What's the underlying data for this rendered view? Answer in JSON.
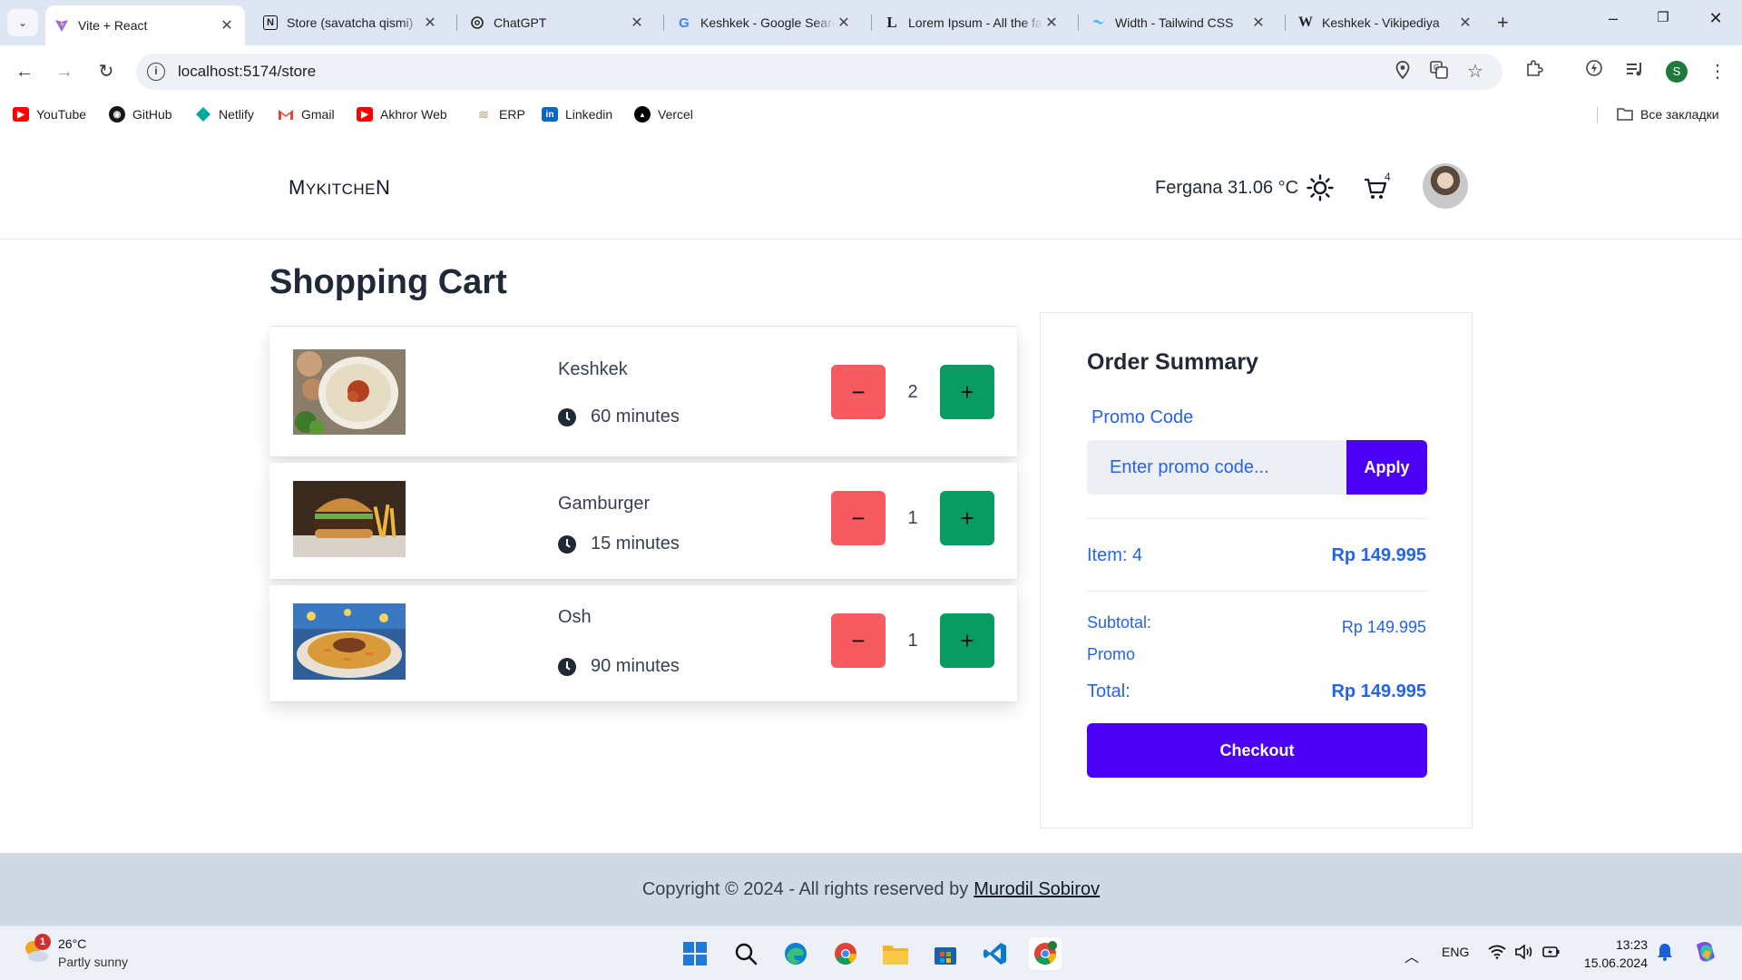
{
  "browser": {
    "tabs": [
      {
        "title": "Vite + React",
        "icon": "vite-icon",
        "active": true
      },
      {
        "title": "Store (savatcha qismi)",
        "icon": "notion-icon"
      },
      {
        "title": "ChatGPT",
        "icon": "chatgpt-icon"
      },
      {
        "title": "Keshkek - Google Search",
        "icon": "google-icon"
      },
      {
        "title": "Lorem Ipsum - All the facts",
        "icon": "lorem-icon"
      },
      {
        "title": "Width - Tailwind CSS",
        "icon": "tailwind-icon"
      },
      {
        "title": "Keshkek - Vikipediya",
        "icon": "wikipedia-icon"
      }
    ],
    "url": "localhost:5174/store",
    "profile_initial": "S",
    "bookmarks": [
      {
        "label": "YouTube",
        "icon": "youtube-icon",
        "color": "#ff0000"
      },
      {
        "label": "GitHub",
        "icon": "github-icon",
        "color": "#181717"
      },
      {
        "label": "Netlify",
        "icon": "netlify-icon",
        "color": "#00a99d"
      },
      {
        "label": "Gmail",
        "icon": "gmail-icon",
        "color": "#ea4335"
      },
      {
        "label": "Akhror Web",
        "icon": "youtube-icon",
        "color": "#ff0000"
      },
      {
        "label": "ERP",
        "icon": "erp-icon",
        "color": "#c8b79a"
      },
      {
        "label": "Linkedin",
        "icon": "linkedin-icon",
        "color": "#0a66c2"
      },
      {
        "label": "Vercel",
        "icon": "vercel-icon",
        "color": "#000000"
      }
    ],
    "all_bookmarks": "Все закладки"
  },
  "header": {
    "logo_first": "M",
    "logo_middle": "YKITCHE",
    "logo_last": "N",
    "weather": "Fergana 31.06 °C",
    "cart_count": "4"
  },
  "cart": {
    "title": "Shopping Cart",
    "items": [
      {
        "name": "Keshkek",
        "time": "60 minutes",
        "quantity": "2",
        "image": "keshkek-image"
      },
      {
        "name": "Gamburger",
        "time": "15 minutes",
        "quantity": "1",
        "image": "hamburger-image"
      },
      {
        "name": "Osh",
        "time": "90 minutes",
        "quantity": "1",
        "image": "osh-image"
      }
    ],
    "minus_symbol": "−",
    "plus_symbol": "+"
  },
  "summary": {
    "title": "Order Summary",
    "promo_label": "Promo Code",
    "promo_placeholder": "Enter promo code...",
    "apply_label": "Apply",
    "items_label": "Item: 4",
    "items_value": "Rp 149.995",
    "subtotal_label": "Subtotal:",
    "subtotal_value": "Rp 149.995",
    "promo_row_label": "Promo",
    "total_label": "Total:",
    "total_value": "Rp 149.995",
    "checkout_label": "Checkout"
  },
  "footer": {
    "text": "Copyright © 2024 - All rights reserved by",
    "author": "Murodil Sobirov"
  },
  "taskbar": {
    "temperature": "26°C",
    "condition": "Partly sunny",
    "weather_badge": "1",
    "language": "ENG",
    "time": "13:23",
    "date": "15.06.2024"
  },
  "colors": {
    "accent": "#4c00f5",
    "minus": "#f75a5f",
    "plus": "#089b62",
    "link": "#2563eb"
  }
}
